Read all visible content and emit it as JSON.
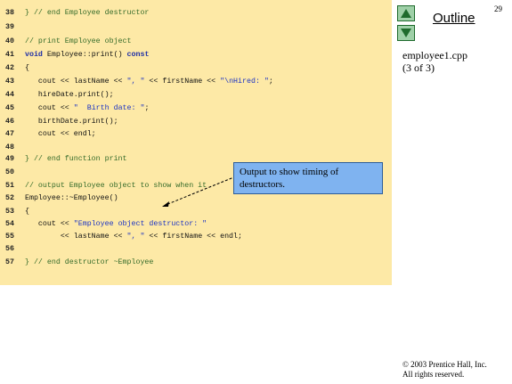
{
  "slide": {
    "number": "29"
  },
  "outline": {
    "title": "Outline",
    "up_icon": "triangle-up-icon",
    "down_icon": "triangle-down-icon"
  },
  "file": {
    "name": "employee1.cpp",
    "part": "(3 of 3)"
  },
  "callout": {
    "text": "Output to show timing of destructors."
  },
  "code_lines": [
    {
      "num": "38",
      "tokens": [
        {
          "t": "} // end Employee destructor",
          "c": "comment"
        }
      ]
    },
    {
      "num": "39",
      "tokens": []
    },
    {
      "num": "40",
      "tokens": [
        {
          "t": "// print Employee object",
          "c": "comment"
        }
      ]
    },
    {
      "num": "41",
      "tokens": [
        {
          "t": "void",
          "c": "keyword"
        },
        {
          "t": " Employee::print() ",
          "c": "plain"
        },
        {
          "t": "const",
          "c": "keyword"
        }
      ]
    },
    {
      "num": "42",
      "tokens": [
        {
          "t": "{",
          "c": "plain"
        }
      ]
    },
    {
      "num": "43",
      "tokens": [
        {
          "t": "   cout << lastName << ",
          "c": "plain"
        },
        {
          "t": "\", \"",
          "c": "string"
        },
        {
          "t": " << firstName << ",
          "c": "plain"
        },
        {
          "t": "\"\\nHired: \"",
          "c": "string"
        },
        {
          "t": ";",
          "c": "plain"
        }
      ]
    },
    {
      "num": "44",
      "tokens": [
        {
          "t": "   hireDate.print();",
          "c": "plain"
        }
      ]
    },
    {
      "num": "45",
      "tokens": [
        {
          "t": "   cout << ",
          "c": "plain"
        },
        {
          "t": "\"  Birth date: \"",
          "c": "string"
        },
        {
          "t": ";",
          "c": "plain"
        }
      ]
    },
    {
      "num": "46",
      "tokens": [
        {
          "t": "   birthDate.print();",
          "c": "plain"
        }
      ]
    },
    {
      "num": "47",
      "tokens": [
        {
          "t": "   cout << endl;",
          "c": "plain"
        }
      ]
    },
    {
      "num": "48",
      "tokens": []
    },
    {
      "num": "49",
      "tokens": [
        {
          "t": "} // end function print",
          "c": "comment"
        }
      ]
    },
    {
      "num": "50",
      "tokens": []
    },
    {
      "num": "51",
      "tokens": [
        {
          "t": "// output Employee object to show when it",
          "c": "comment"
        }
      ]
    },
    {
      "num": "52",
      "tokens": [
        {
          "t": "Employee::~Employee()",
          "c": "plain"
        }
      ]
    },
    {
      "num": "53",
      "tokens": [
        {
          "t": "{",
          "c": "plain"
        }
      ]
    },
    {
      "num": "54",
      "tokens": [
        {
          "t": "   cout << ",
          "c": "plain"
        },
        {
          "t": "\"Employee object destructor: \"",
          "c": "string"
        }
      ]
    },
    {
      "num": "55",
      "tokens": [
        {
          "t": "        << lastName << ",
          "c": "plain"
        },
        {
          "t": "\", \"",
          "c": "string"
        },
        {
          "t": " << firstName << endl;",
          "c": "plain"
        }
      ]
    },
    {
      "num": "56",
      "tokens": []
    },
    {
      "num": "57",
      "tokens": [
        {
          "t": "} // end destructor ~Employee",
          "c": "comment"
        }
      ]
    }
  ],
  "copyright": {
    "line1": "© 2003 Prentice Hall, Inc.",
    "line2": "All rights reserved."
  }
}
